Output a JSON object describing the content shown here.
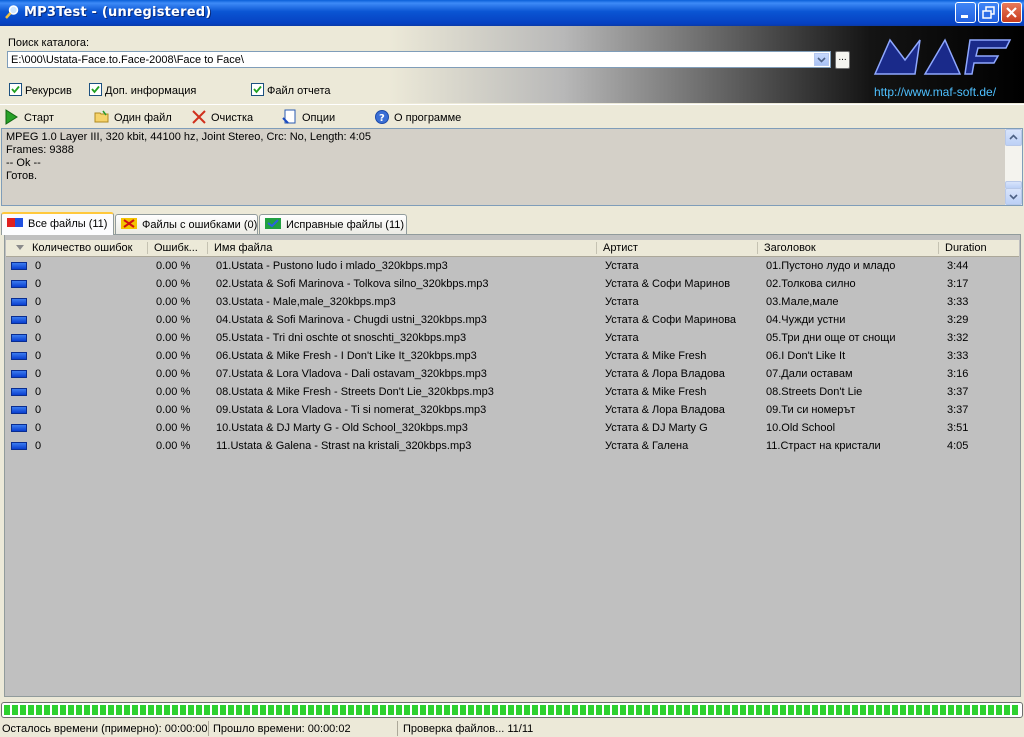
{
  "window": {
    "title": "MP3Test -  (unregistered)"
  },
  "catalog": {
    "label": "Поиск каталога:",
    "path": "E:\\000\\Ustata-Face.to.Face-2008\\Face to Face\\",
    "browse_label": "..."
  },
  "options": {
    "recursive": "Рекурсив",
    "extra_info": "Доп. информация",
    "report_file": "Файл отчета"
  },
  "brand": {
    "logo_text": "MAF",
    "url": "http://www.maf-soft.de/"
  },
  "toolbar": {
    "start": "Старт",
    "one_file": "Один файл",
    "clear": "Очистка",
    "options": "Опции",
    "about": "О программе"
  },
  "log": {
    "lines": [
      "MPEG 1.0 Layer III, 320 kbit, 44100 hz, Joint Stereo, Crc: No, Length: 4:05",
      "Frames: 9388",
      "-- Ok --",
      "Готов."
    ]
  },
  "tabs": [
    {
      "label": "Все файлы (11)"
    },
    {
      "label": "Файлы с ошибками (0)"
    },
    {
      "label": "Исправные файлы (11)"
    }
  ],
  "grid": {
    "columns": [
      "Количество ошибок",
      "Ошибк...",
      "Имя файла",
      "Артист",
      "Заголовок",
      "Duration"
    ],
    "rows": [
      {
        "errors": "0",
        "pct": "0.00 %",
        "file": "01.Ustata - Pustono ludo i mlado_320kbps.mp3",
        "artist": "Устата",
        "title": "01.Пустоно лудо и младо",
        "duration": "3:44"
      },
      {
        "errors": "0",
        "pct": "0.00 %",
        "file": "02.Ustata & Sofi Marinova - Tolkova silno_320kbps.mp3",
        "artist": "Устата & Софи Маринов",
        "title": "02.Толкова силно",
        "duration": "3:17"
      },
      {
        "errors": "0",
        "pct": "0.00 %",
        "file": "03.Ustata - Male,male_320kbps.mp3",
        "artist": "Устата",
        "title": "03.Мале,мале",
        "duration": "3:33"
      },
      {
        "errors": "0",
        "pct": "0.00 %",
        "file": "04.Ustata & Sofi Marinova - Chugdi ustni_320kbps.mp3",
        "artist": "Устата & Софи Маринова",
        "title": "04.Чужди устни",
        "duration": "3:29"
      },
      {
        "errors": "0",
        "pct": "0.00 %",
        "file": "05.Ustata - Tri dni oschte ot snoschti_320kbps.mp3",
        "artist": "Устата",
        "title": "05.Три дни още от снощи",
        "duration": "3:32"
      },
      {
        "errors": "0",
        "pct": "0.00 %",
        "file": "06.Ustata & Mike Fresh - I Don't Like It_320kbps.mp3",
        "artist": "Устата & Mike Fresh",
        "title": "06.I Don't Like It",
        "duration": "3:33"
      },
      {
        "errors": "0",
        "pct": "0.00 %",
        "file": "07.Ustata & Lora Vladova - Dali ostavam_320kbps.mp3",
        "artist": "Устата & Лора Владова",
        "title": "07.Дали оставам",
        "duration": "3:16"
      },
      {
        "errors": "0",
        "pct": "0.00 %",
        "file": "08.Ustata & Mike Fresh - Streets Don't Lie_320kbps.mp3",
        "artist": "Устата & Mike Fresh",
        "title": "08.Streets Don't Lie",
        "duration": "3:37"
      },
      {
        "errors": "0",
        "pct": "0.00 %",
        "file": "09.Ustata & Lora Vladova - Ti si nomerat_320kbps.mp3",
        "artist": "Устата & Лора Владова",
        "title": "09.Ти си номерът",
        "duration": "3:37"
      },
      {
        "errors": "0",
        "pct": "0.00 %",
        "file": "10.Ustata & DJ Marty G - Old School_320kbps.mp3",
        "artist": "Устата & DJ Marty G",
        "title": "10.Old School",
        "duration": "3:51"
      },
      {
        "errors": "0",
        "pct": "0.00 %",
        "file": "11.Ustata & Galena - Strast na kristali_320kbps.mp3",
        "artist": "Устата & Галена",
        "title": "11.Страст на кристали",
        "duration": "4:05"
      }
    ]
  },
  "progress": {
    "fraction": 1.0
  },
  "status": {
    "remaining": "Осталось времени (примерно): 00:00:00",
    "elapsed": "Прошло времени: 00:00:02",
    "checking": "Проверка файлов... 11/11"
  }
}
